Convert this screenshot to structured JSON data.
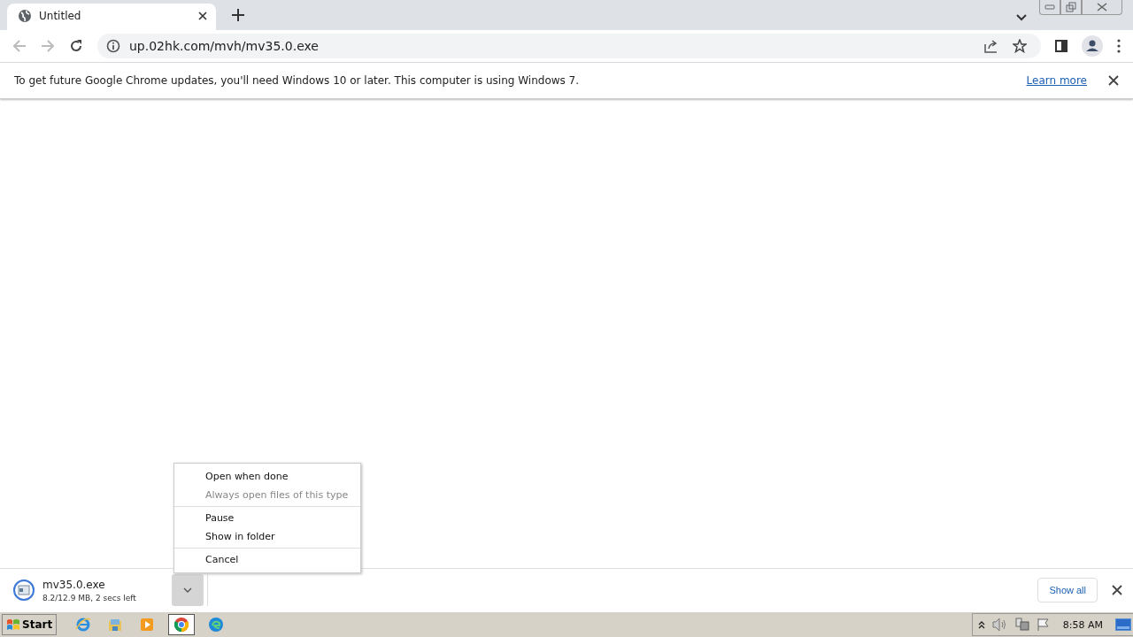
{
  "tab": {
    "title": "Untitled"
  },
  "address": {
    "url": "up.02hk.com/mvh/mv35.0.exe"
  },
  "infobar": {
    "message": "To get future Google Chrome updates, you'll need Windows 10 or later. This computer is using Windows 7.",
    "link": "Learn more"
  },
  "context_menu": {
    "groups": [
      [
        {
          "label": "Open when done",
          "disabled": false
        },
        {
          "label": "Always open files of this type",
          "disabled": true
        }
      ],
      [
        {
          "label": "Pause",
          "disabled": false
        },
        {
          "label": "Show in folder",
          "disabled": false
        }
      ],
      [
        {
          "label": "Cancel",
          "disabled": false
        }
      ]
    ]
  },
  "download": {
    "filename": "mv35.0.exe",
    "status": "8.2/12.9 MB, 2 secs left",
    "show_all": "Show all"
  },
  "taskbar": {
    "start": "Start",
    "apps": [
      {
        "kind": "ie",
        "selected": false
      },
      {
        "kind": "explorer",
        "selected": false
      },
      {
        "kind": "media",
        "selected": false
      },
      {
        "kind": "chrome",
        "selected": true
      },
      {
        "kind": "edge",
        "selected": false
      }
    ],
    "clock": "8:58 AM"
  }
}
